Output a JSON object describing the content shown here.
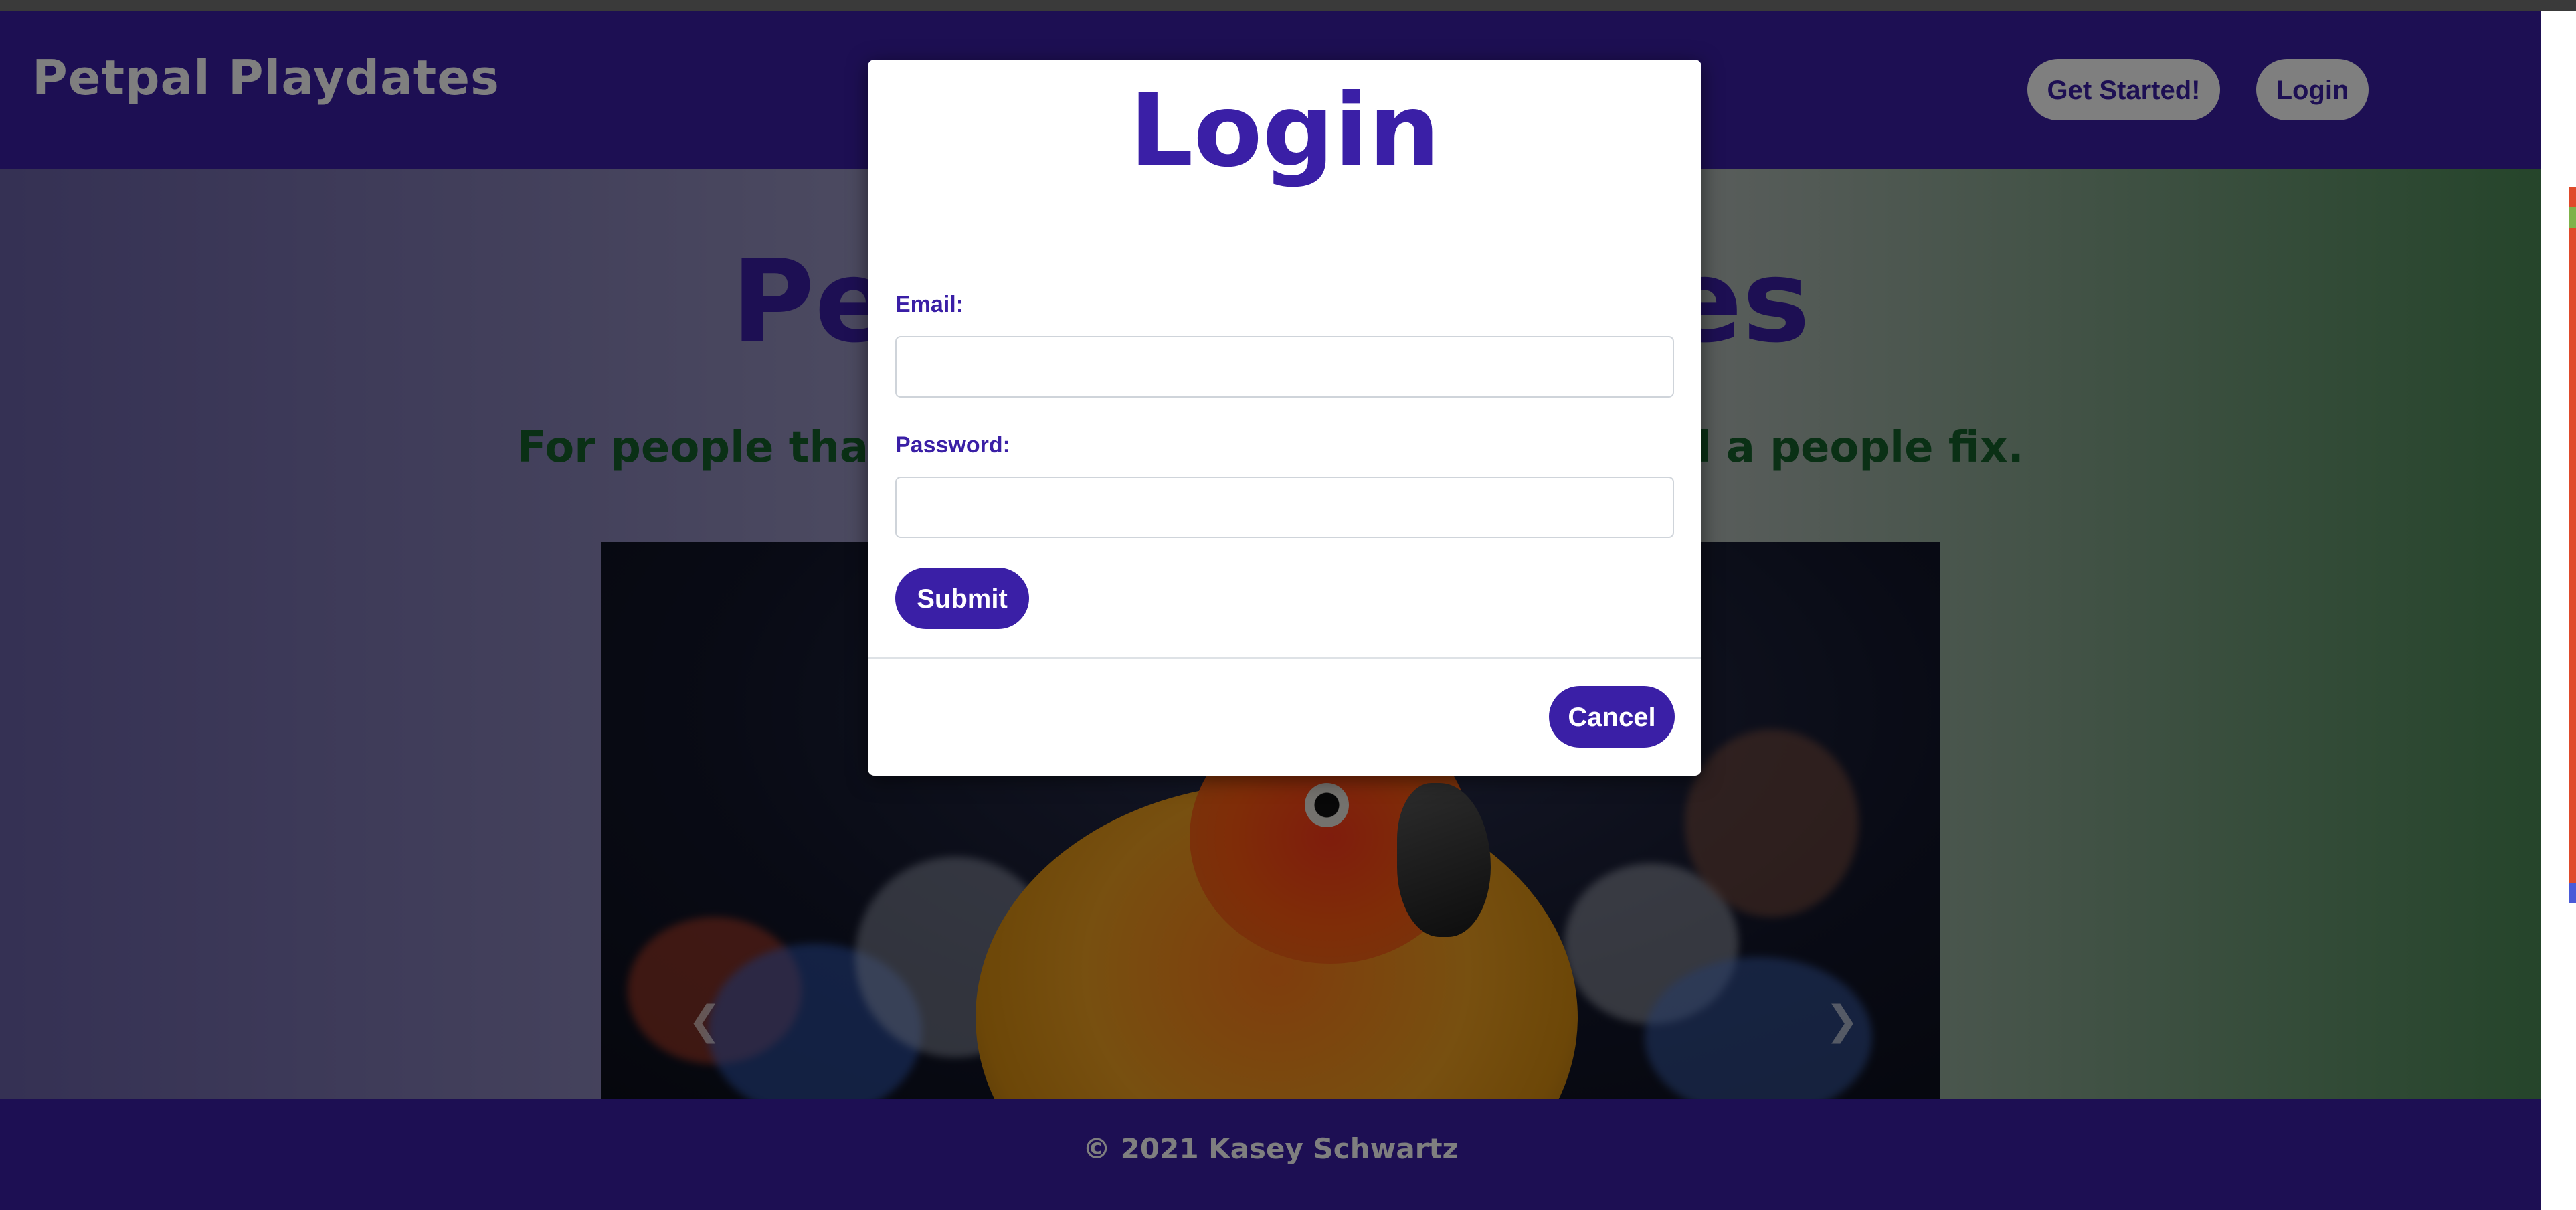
{
  "navbar": {
    "brand": "Petpal Playdates",
    "get_started_label": "Get Started!",
    "login_label": "Login"
  },
  "hero": {
    "title": "Petpal Playdates",
    "subtitle": "For people that need a pet fix and pets that need a people fix."
  },
  "carousel": {
    "prev_icon": "chevron-left-icon",
    "next_icon": "chevron-right-icon"
  },
  "footer": {
    "text": "© 2021 Kasey Schwartz"
  },
  "modal": {
    "title": "Login",
    "email_label": "Email:",
    "email_value": "",
    "password_label": "Password:",
    "password_value": "",
    "submit_label": "Submit",
    "cancel_label": "Cancel"
  },
  "colors": {
    "primary": "#3a1fa6",
    "subtitle_green": "#15612a",
    "nav_button_bg": "#ffffff",
    "backdrop": "rgba(0,0,0,0.5)"
  }
}
